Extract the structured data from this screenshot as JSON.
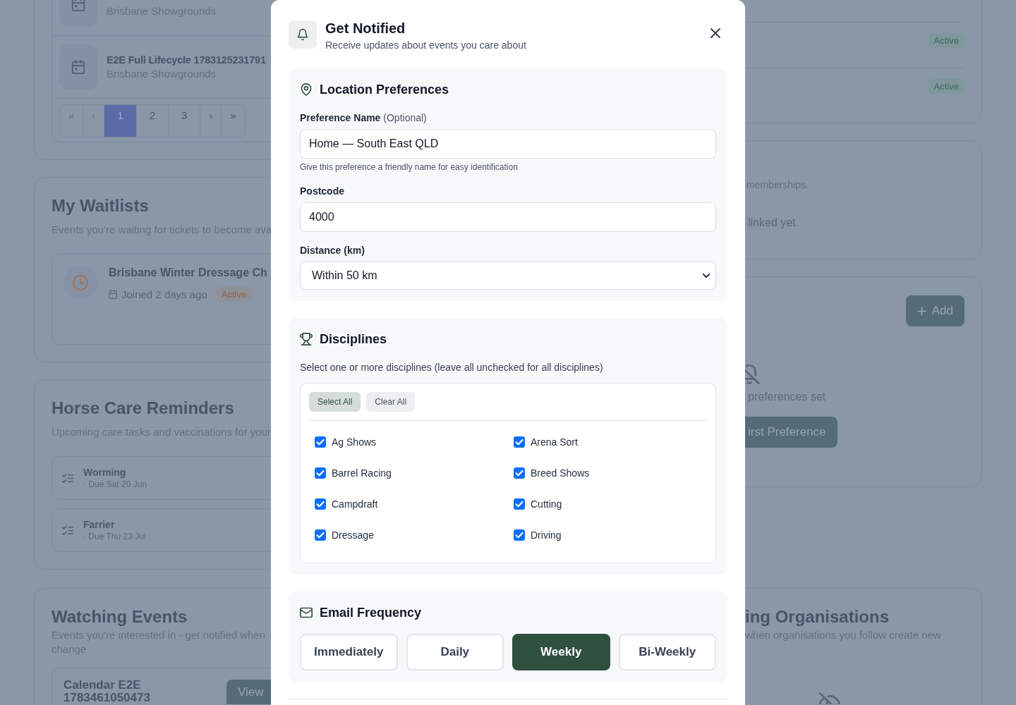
{
  "page": {
    "event_list": {
      "items": [
        {
          "subtitle": "Brisbane Showgrounds"
        },
        {
          "title": "E2E Full Lifecycle 1783125231791",
          "subtitle": "Brisbane Showgrounds"
        }
      ],
      "pagination": [
        {
          "label": "«",
          "selected": false,
          "disabled": true
        },
        {
          "label": "‹",
          "selected": false,
          "disabled": true
        },
        {
          "label": "1",
          "selected": true,
          "disabled": false
        },
        {
          "label": "2",
          "selected": false,
          "disabled": false
        },
        {
          "label": "3",
          "selected": false,
          "disabled": false
        },
        {
          "label": "›",
          "selected": false,
          "disabled": false
        },
        {
          "label": "»",
          "selected": false,
          "disabled": false
        }
      ]
    },
    "status_list": {
      "items": [
        {
          "badge": "Active"
        },
        {
          "badge": "Active"
        }
      ]
    },
    "waitlists": {
      "title": "My Waitlists",
      "subtitle": "Events you're waiting for tickets to become ava",
      "items": [
        {
          "title": "Brisbane Winter Dressage Ch",
          "joined": "Joined 2 days ago",
          "badge": "Active"
        }
      ]
    },
    "memberships": {
      "subtitle": "memberships.",
      "empty_text": "linked yet."
    },
    "preferences": {
      "add_button": "Add",
      "empty_text": "preferences set",
      "cta_button": "irst Preference"
    },
    "care_reminders": {
      "title": "Horse Care Reminders",
      "subtitle": "Upcoming care tasks and vaccinations for your",
      "items": [
        {
          "title": "Worming",
          "due": "· Due Sat 20 Jun"
        },
        {
          "title": "Farrier",
          "due": "· Due Thu 23 Jul"
        }
      ]
    },
    "watching_events": {
      "title": "Watching Events",
      "subtitle_lines": [
        "Events you're interested in - get notified when",
        "change"
      ],
      "items": [
        {
          "title": "Calendar E2E 1783461050473",
          "button": "View"
        }
      ]
    },
    "organisations": {
      "title": "ing Organisations",
      "subtitle": "when organisations you follow create new"
    }
  },
  "modal": {
    "title": "Get Notified",
    "subtitle": "Receive updates about events you care about",
    "sections": [
      {
        "kind": "location",
        "title": "Location Preferences",
        "fields": [
          {
            "kind": "text",
            "label": "Preference Name",
            "label_note": "(Optional)",
            "value": "Home — South East QLD",
            "hint": "Give this preference a friendly name for easy identification"
          },
          {
            "kind": "text",
            "label": "Postcode",
            "value": "4000"
          },
          {
            "kind": "select",
            "label": "Distance (km)",
            "value": "Within 50 km"
          }
        ]
      },
      {
        "kind": "disciplines",
        "title": "Disciplines",
        "description": "Select one or more disciplines (leave all unchecked for all disciplines)",
        "actions": [
          {
            "label": "Select All",
            "kind": "primary"
          },
          {
            "label": "Clear All",
            "kind": "secondary"
          }
        ],
        "options": [
          {
            "label": "Ag Shows",
            "checked": true
          },
          {
            "label": "Arena Sort",
            "checked": true
          },
          {
            "label": "Barrel Racing",
            "checked": true
          },
          {
            "label": "Breed Shows",
            "checked": true
          },
          {
            "label": "Campdraft",
            "checked": true
          },
          {
            "label": "Cutting",
            "checked": true
          },
          {
            "label": "Dressage",
            "checked": true
          },
          {
            "label": "Driving",
            "checked": true
          }
        ]
      },
      {
        "kind": "frequency",
        "title": "Email Frequency",
        "options": [
          {
            "label": "Immediately",
            "selected": false
          },
          {
            "label": "Daily",
            "selected": false
          },
          {
            "label": "Weekly",
            "selected": true
          },
          {
            "label": "Bi-Weekly",
            "selected": false
          }
        ]
      }
    ]
  }
}
